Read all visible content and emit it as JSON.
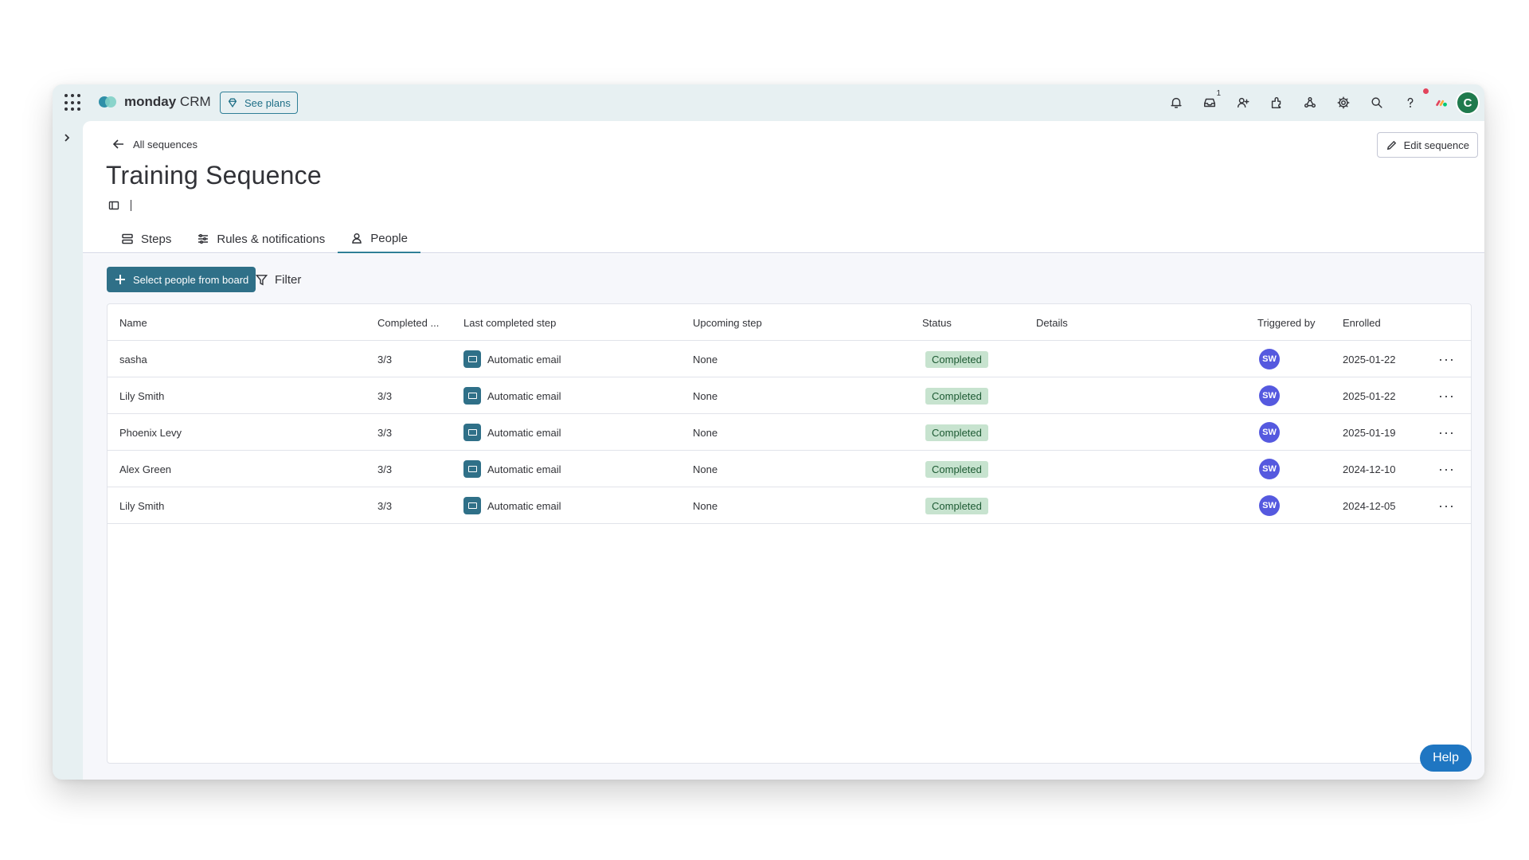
{
  "app": {
    "brand_bold": "monday",
    "brand_light": "CRM",
    "see_plans": "See plans",
    "inbox_count": "1",
    "user_initial": "C"
  },
  "header": {
    "back_label": "All sequences",
    "title": "Training Sequence",
    "edit_label": "Edit sequence"
  },
  "tabs": [
    {
      "label": "Steps",
      "icon": "steps-icon"
    },
    {
      "label": "Rules & notifications",
      "icon": "sliders-icon"
    },
    {
      "label": "People",
      "icon": "person-icon",
      "active": true
    }
  ],
  "toolbar": {
    "select_label": "Select people from board",
    "filter_label": "Filter"
  },
  "table": {
    "columns": [
      "Name",
      "Completed ...",
      "Last completed step",
      "Upcoming step",
      "Status",
      "Details",
      "Triggered by",
      "Enrolled"
    ],
    "rows": [
      {
        "name": "sasha",
        "completed": "3/3",
        "last_step": "Automatic email",
        "upcoming": "None",
        "status": "Completed",
        "details": "",
        "triggered": "SW",
        "enrolled": "2025-01-22"
      },
      {
        "name": "Lily Smith",
        "completed": "3/3",
        "last_step": "Automatic email",
        "upcoming": "None",
        "status": "Completed",
        "details": "",
        "triggered": "SW",
        "enrolled": "2025-01-22"
      },
      {
        "name": "Phoenix Levy",
        "completed": "3/3",
        "last_step": "Automatic email",
        "upcoming": "None",
        "status": "Completed",
        "details": "",
        "triggered": "SW",
        "enrolled": "2025-01-19"
      },
      {
        "name": "Alex Green",
        "completed": "3/3",
        "last_step": "Automatic email",
        "upcoming": "None",
        "status": "Completed",
        "details": "",
        "triggered": "SW",
        "enrolled": "2024-12-10"
      },
      {
        "name": "Lily Smith",
        "completed": "3/3",
        "last_step": "Automatic email",
        "upcoming": "None",
        "status": "Completed",
        "details": "",
        "triggered": "SW",
        "enrolled": "2024-12-05"
      }
    ]
  },
  "help_label": "Help",
  "colors": {
    "accent": "#2f7088",
    "status_completed_bg": "#c7e3cf",
    "avatar_sw": "#5559df",
    "help": "#1f76c2"
  }
}
